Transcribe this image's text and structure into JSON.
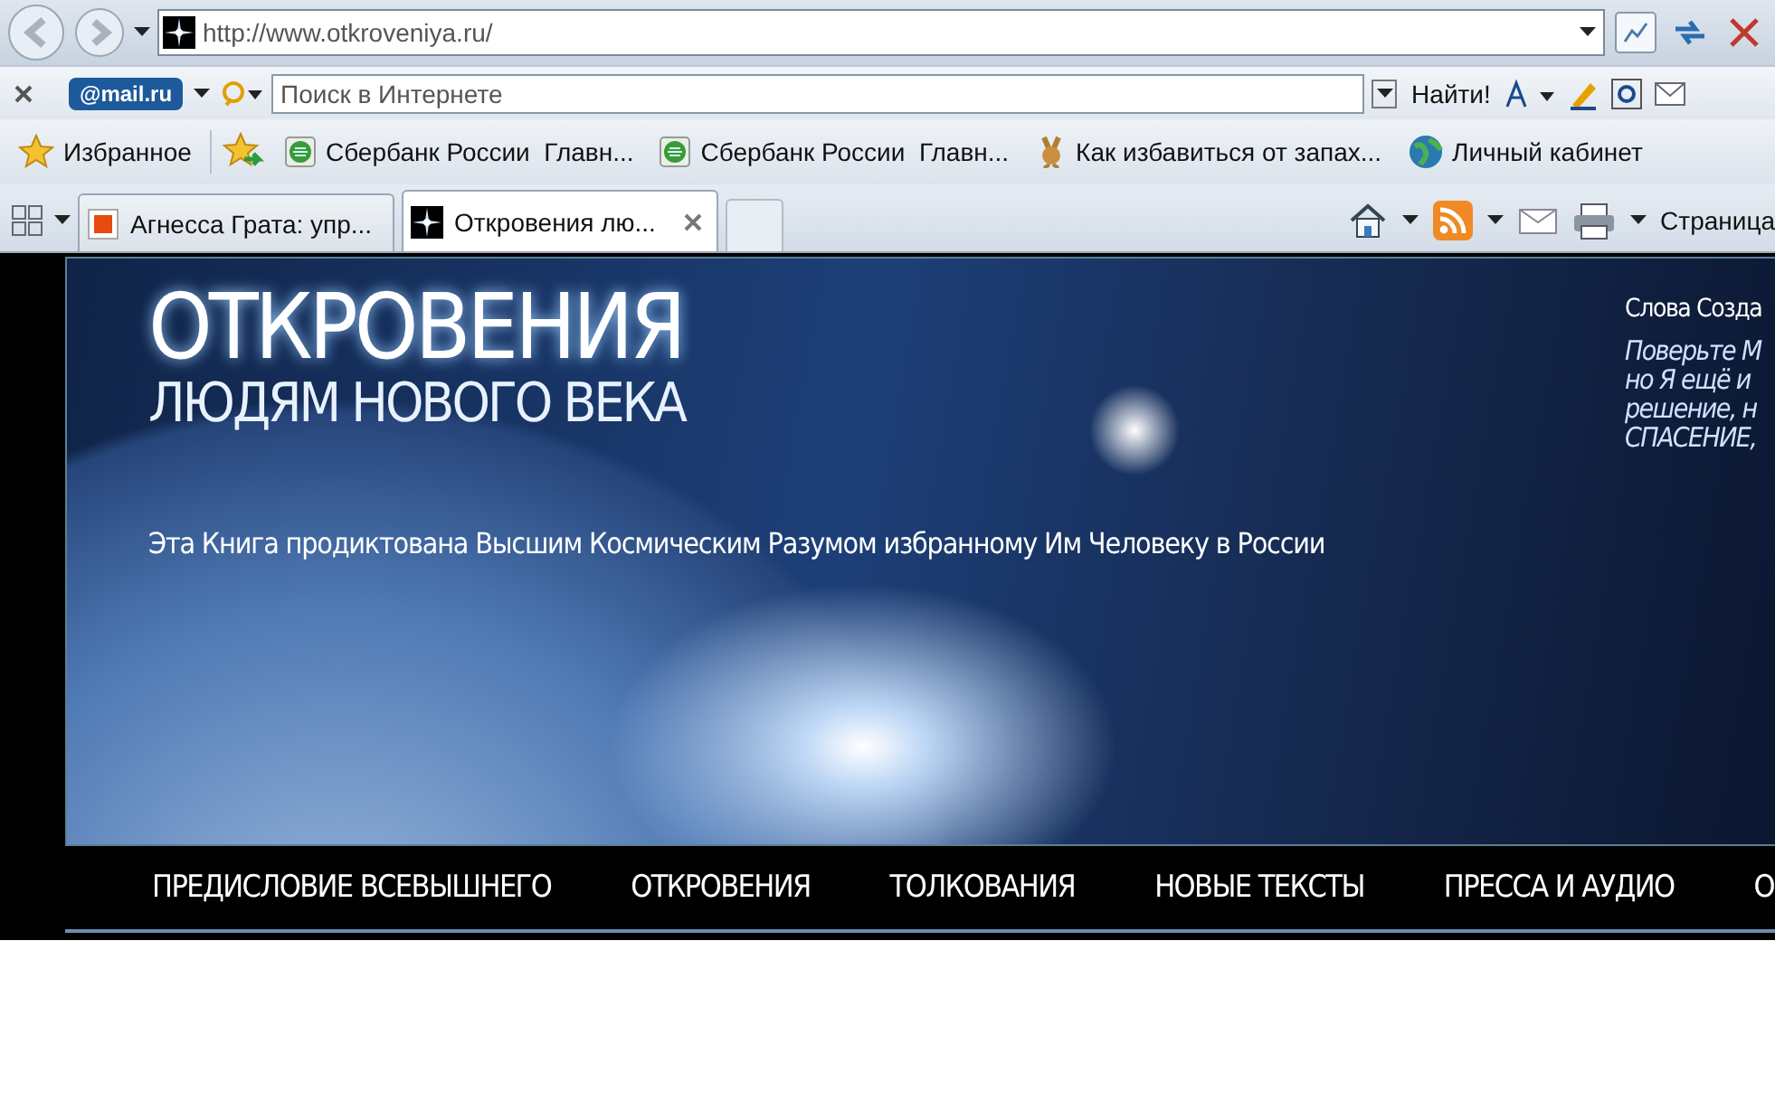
{
  "browser": {
    "address": "http://www.otkroveniya.ru/",
    "mail_logo": "@mail.ru",
    "search_placeholder": "Поиск в Интернете",
    "search_button": "Найти!",
    "favorites_button": "Избранное",
    "favorites": [
      {
        "label": "Сбербанк России  Главн...",
        "kind": "bank"
      },
      {
        "label": "Сбербанк России  Главн...",
        "kind": "bank"
      },
      {
        "label": "Как избавиться от запах...",
        "kind": "bunny"
      },
      {
        "label": "Личный кабинет",
        "kind": "globe"
      }
    ],
    "tabs": [
      {
        "label": "Агнесса Грата: упр...",
        "selected": false
      },
      {
        "label": "Откровения лю...",
        "selected": true
      }
    ],
    "page_menu": "Страница"
  },
  "site": {
    "title": "ОТКРОВЕНИЯ",
    "subtitle": "ЛЮДЯМ НОВОГО ВЕКА",
    "tagline": "Эта Книга продиктована Высшим Космическим Разумом избранному Им Человеку в России",
    "quote_heading": "Слова Созда",
    "quote_lines": [
      "Поверьте М",
      "но Я ещё и",
      "решение, н",
      "СПАСЕНИЕ,"
    ]
  },
  "nav": [
    "ПРЕДИСЛОВИЕ ВСЕВЫШНЕГО",
    "ОТКРОВЕНИЯ",
    "ТОЛКОВАНИЯ",
    "НОВЫЕ ТЕКСТЫ",
    "ПРЕССА И АУДИО",
    "О"
  ]
}
